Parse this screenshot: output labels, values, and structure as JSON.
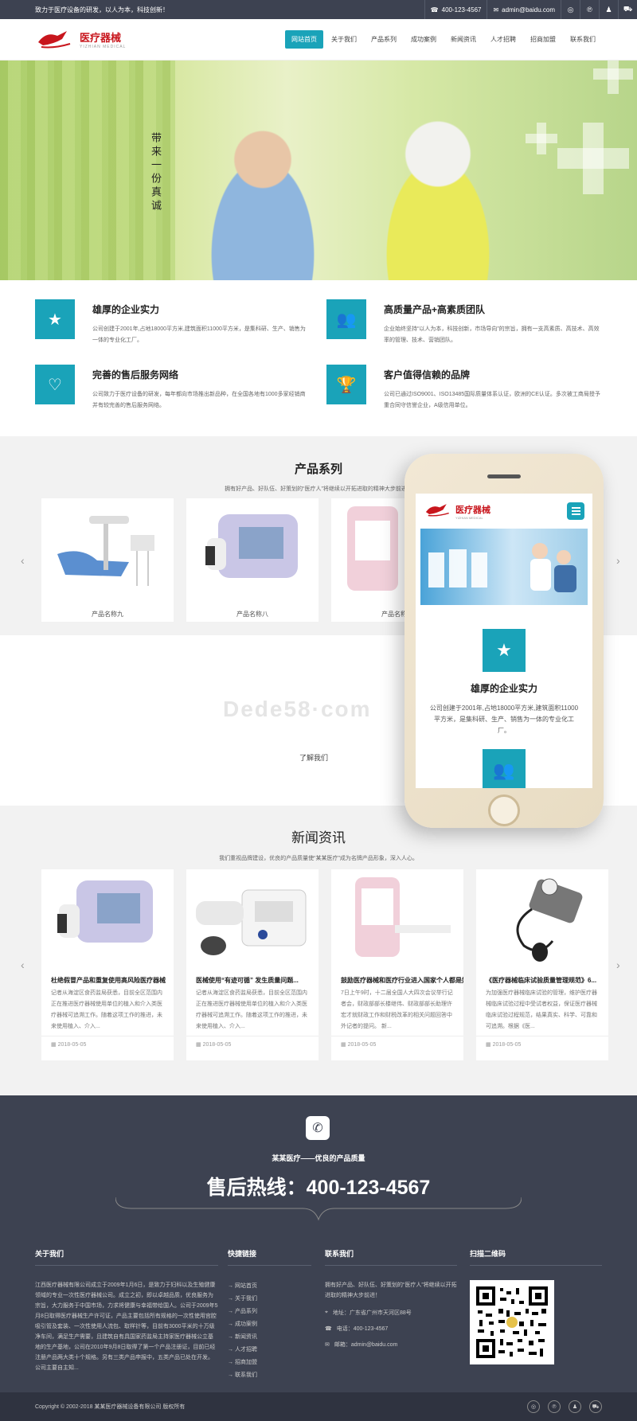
{
  "topbar": {
    "slogan": "致力于医疗设备的研发，以人为本，科技创新！",
    "phone": "400-123-4567",
    "email": "admin@baidu.com"
  },
  "header": {
    "logo_text": "医疗器械",
    "logo_sub": "YIZHIAN MEDICAL",
    "nav": [
      "网站首页",
      "关于我们",
      "产品系列",
      "成功案例",
      "新闻资讯",
      "人才招聘",
      "招商加盟",
      "联系我们"
    ]
  },
  "banner": {
    "calligraphy": "带来一份真诚"
  },
  "features": [
    {
      "title": "雄厚的企业实力",
      "text": "公司创建于2001年,占地18000平方米,建筑面积11000平方米，是集科研、生产、销售为一体的专业化工厂。",
      "icon": "star-icon"
    },
    {
      "title": "高质量产品+高素质团队",
      "text": "企业始终坚持“以人为本，科技创新，市场导向”的宗旨，拥有一支高素质、高技术、高效率的管理、技术、营销团队。",
      "icon": "users-icon"
    },
    {
      "title": "完善的售后服务网络",
      "text": "公司致力于医疗设备的研发，每年都向市场推出新品种，在全国各地有1000多家经销商并有较完善的售后服务网络。",
      "icon": "heart-icon"
    },
    {
      "title": "客户值得信赖的品牌",
      "text": "公司已通过ISO9001、ISO13485国际质量体系认证，欧洲的CE认证。多次被工商局授予重合同守信誉企业，A级信用单位。",
      "icon": "trophy-icon"
    }
  ],
  "products": {
    "title": "产品系列",
    "subtitle": "拥有好产品、好队伍、好策划的“医疗人”将继续以开拓进取的精神大步前进！",
    "items": [
      {
        "name": "产品名称九"
      },
      {
        "name": "产品名称八"
      },
      {
        "name": "产品名称七"
      }
    ]
  },
  "about_link": "了解我们",
  "watermark": "Dede58·com",
  "news": {
    "title": "新闻资讯",
    "subtitle": "我们重视品牌建设，优良的产品质量使“某某医疗”成为名牌产品形象，深入人心。",
    "items": [
      {
        "title": "杜绝假冒产品和重复使用高风险医疗器械",
        "text": "记者从海淀区食药监局获悉，目前全区范围内正在推进医疗器械使用单位的植入和介入类医疗器械可追溯工作。随着这项工作的推进，未来使用植入、介入...",
        "date": "2018-05-05"
      },
      {
        "title": "医械使用“有迹可循” 发生质量问题...",
        "text": "记者从海淀区食药监局获悉，目前全区范围内正在推进医疗器械使用单位的植入和介入类医疗器械可追溯工作。随着这项工作的推进，未来使用植入、介入...",
        "date": "2018-05-05"
      },
      {
        "title": "鼓励医疗器械和医疗行业进入国家个人都是好",
        "text": "7日上午9时，十二届全国人大四次会议举行记者会，财政部部长楼继伟、财政部部长助理许宏才就财政工作和财税改革的相关问题回答中外记者的提问。 新...",
        "date": "2018-05-05"
      },
      {
        "title": "《医疗器械临床试验质量管理规范》6...",
        "text": "为加强医疗器械临床试验的管理，维护医疗器械临床试验过程中受试者权益，保证医疗器械临床试验过程规范，结果真实、科学、可靠和可追溯。根据《医...",
        "date": "2018-05-05"
      }
    ]
  },
  "hotline": {
    "subtitle": "某某医疗——优良的产品质量",
    "line": "售后热线：400-123-4567"
  },
  "footer": {
    "about_title": "关于我们",
    "about_text": "江西医疗器械有限公司成立于2009年1月6日，是致力于妇科以及生殖健康领域的专业一次性医疗器械公司。成立之初，即以卓越品质，优良服务为宗旨，大力服务于中国市场，力求将健康与幸福带给国人。公司于2009年5月8日取得医疗器械生产许可证，产品主要包括所有规格的一次性使用宫腔吸引管及套装、一次性使用人流包、取样针等，目前有3000平米的十万级净车间，满足生产需要，且建筑自有具国家药监局主持家医疗器械公立基地的生产基地，公司在2010年9月8日取得了第一个产品注册证，目前已经注册产品两大类十个规格。另有三类产品申报中，五类产品已处在开发。公司主要自主知...",
    "links_title": "快捷链接",
    "links": [
      "网站首页",
      "关于我们",
      "产品系列",
      "成功案例",
      "新闻资讯",
      "人才招聘",
      "招商加盟",
      "联系我们"
    ],
    "contact_title": "联系我们",
    "contact_text": "拥有好产品、好队伍、好策划的“医疗人”将继续以开拓进取的精神大步前进！",
    "address": "地址：广东省广州市天河区88号",
    "phone": "电话：400-123-4567",
    "email": "邮箱：admin@baidu.com",
    "qr_title": "扫描二维码"
  },
  "copyright": "Copyright © 2002-2018 某某医疗器械设备有限公司 版权所有",
  "phone_mock": {
    "logo_text": "医疗器械",
    "logo_sub": "YIZHIAN MEDICAL",
    "feature_title": "雄厚的企业实力",
    "feature_text": "公司创建于2001年,占地18000平方米,建筑面积11000平方米，是集科研、生产、销售为一体的专业化工厂。"
  },
  "colors": {
    "accent": "#1aa3b9",
    "dark": "#3d4251",
    "brand_red": "#c8161d"
  }
}
